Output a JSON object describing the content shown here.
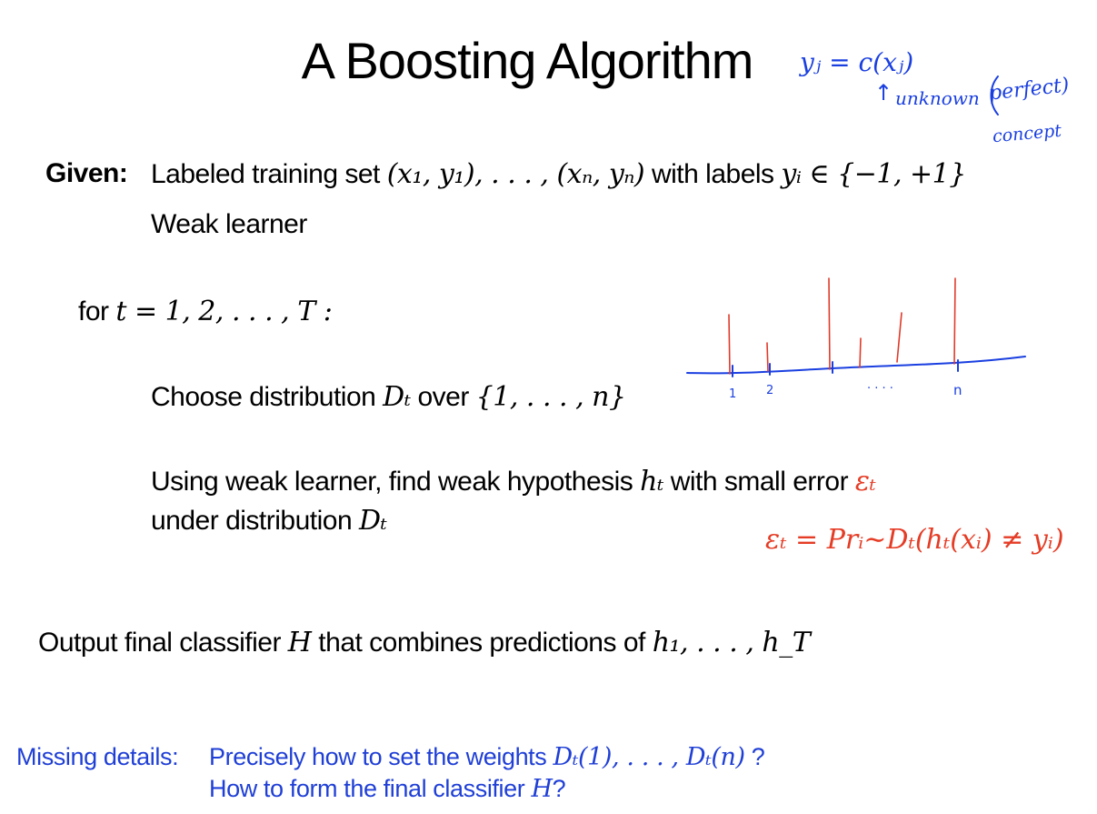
{
  "slide": {
    "title": "A Boosting Algorithm",
    "given_label": "Given:",
    "given_line1_a": "Labeled training set ",
    "given_line1_math": "(x₁, y₁), . . . , (xₙ, yₙ)",
    "given_line1_b": " with labels ",
    "given_line1_labels": "yᵢ ∈ {−1, +1}",
    "given_line2": "Weak learner",
    "loop_keyword": "for",
    "loop_math": "t = 1, 2, . . . , T :",
    "step1_text": "Choose distribution ",
    "step1_math": "Dₜ",
    "step1_text2": " over ",
    "step1_set": "{1, . . . , n}",
    "step2_text": "Using weak learner, find weak hypothesis ",
    "step2_h": "hₜ",
    "step2_text2": " with small error ",
    "step2_eps": "εₜ",
    "step2_line2": "under distribution ",
    "step2_D": "Dₜ",
    "error_formula": "εₜ = Prᵢ∼Dₜ(hₜ(xᵢ) ≠ yᵢ)",
    "output_text": "Output final classifier ",
    "output_H": "H",
    "output_text2": " that combines predictions of ",
    "output_hs": "h₁, . . . , h_T",
    "missing_label": "Missing details:",
    "missing_q1_text": "Precisely how to set the weights ",
    "missing_q1_math": "Dₜ(1), . . . , Dₜ(n)",
    "missing_q1_end": " ?",
    "missing_q2_text": "How to form the final classifier ",
    "missing_q2_H": "H",
    "missing_q2_end": "?"
  },
  "annotations": {
    "note_equation": "yⱼ = c(xⱼ)",
    "note_arrow": "↑",
    "note_word1": "unknown",
    "note_word2": "perfect)",
    "note_word3": "concept",
    "tick_label_1": "1",
    "tick_label_2": "2",
    "tick_label_dots": "· · · ·",
    "tick_label_n": "n"
  },
  "colors": {
    "text": "#000000",
    "red_accent": "#e53c25",
    "blue_accent": "#1f3fd6",
    "ink_blue": "#1a3fe0",
    "ink_red": "#e03a2a"
  }
}
